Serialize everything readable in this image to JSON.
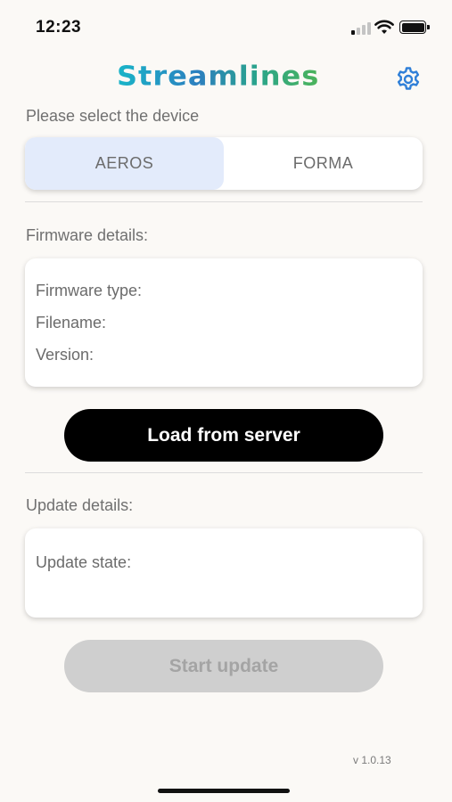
{
  "status_bar": {
    "time": "12:23"
  },
  "header": {
    "app_name": "Streamlines",
    "settings_icon": "gear-icon"
  },
  "device_select": {
    "label": "Please select the device",
    "options": [
      "AEROS",
      "FORMA"
    ],
    "selected": "AEROS"
  },
  "firmware": {
    "label": "Firmware details:",
    "type_label": "Firmware type:",
    "filename_label": "Filename:",
    "version_label": "Version:"
  },
  "load_button": {
    "label": "Load from server"
  },
  "update": {
    "label": "Update details:",
    "state_label": "Update state:"
  },
  "start_button": {
    "label": "Start update"
  },
  "footer": {
    "version": "v 1.0.13"
  },
  "colors": {
    "accent": "#2f7fd8",
    "selected_segment": "#e3ebfb",
    "primary_button": "#000000",
    "disabled_button": "#cfcfcf"
  }
}
